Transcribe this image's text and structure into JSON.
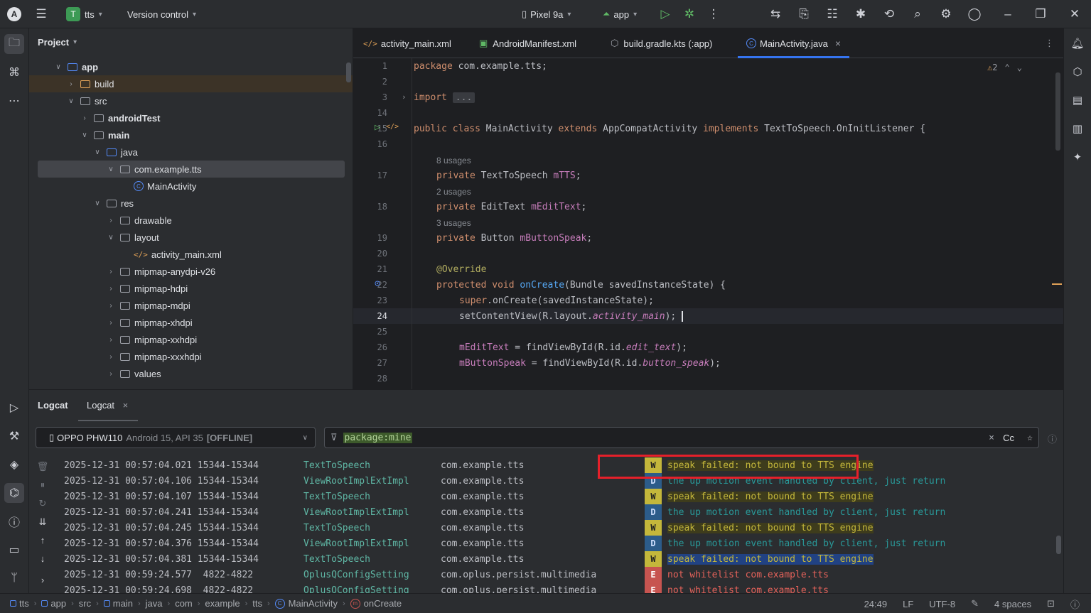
{
  "titlebar": {
    "project_badge": "T",
    "project_name": "tts",
    "vcs": "Version control",
    "device": "Pixel 9a",
    "run_config": "app"
  },
  "project_panel": {
    "title": "Project",
    "tree": [
      {
        "label": "app",
        "bold": true
      },
      {
        "label": "build"
      },
      {
        "label": "src"
      },
      {
        "label": "androidTest",
        "bold": true
      },
      {
        "label": "main",
        "bold": true
      },
      {
        "label": "java"
      },
      {
        "label": "com.example.tts"
      },
      {
        "label": "MainActivity"
      },
      {
        "label": "res"
      },
      {
        "label": "drawable"
      },
      {
        "label": "layout"
      },
      {
        "label": "activity_main.xml"
      },
      {
        "label": "mipmap-anydpi-v26"
      },
      {
        "label": "mipmap-hdpi"
      },
      {
        "label": "mipmap-mdpi"
      },
      {
        "label": "mipmap-xhdpi"
      },
      {
        "label": "mipmap-xxhdpi"
      },
      {
        "label": "mipmap-xxxhdpi"
      },
      {
        "label": "values"
      }
    ]
  },
  "tabs": [
    {
      "label": "activity_main.xml"
    },
    {
      "label": "AndroidManifest.xml"
    },
    {
      "label": "build.gradle.kts (:app)"
    },
    {
      "label": "MainActivity.java",
      "active": true
    }
  ],
  "editor": {
    "warnings": "2",
    "line_numbers": [
      "1",
      "2",
      "3",
      "14",
      "15",
      "16",
      "17",
      "18",
      "19",
      "20",
      "21",
      "22",
      "23",
      "24",
      "25",
      "26",
      "27",
      "28"
    ],
    "usages": [
      "8 usages",
      "2 usages",
      "3 usages"
    ],
    "code": {
      "l1_kw": "package",
      "l1_rest": " com.example.tts;",
      "l3_kw": "import",
      "l3_fold": "...",
      "l15_a": "public class",
      "l15_b": " MainActivity ",
      "l15_c": "extends",
      "l15_d": " AppCompatActivity ",
      "l15_e": "implements",
      "l15_f": " TextToSpeech.OnInitListener {",
      "l17_kw": "private",
      "l17_type": " TextToSpeech ",
      "l17_fld": "mTTS",
      "l17_end": ";",
      "l18_kw": "private",
      "l18_type": " EditText ",
      "l18_fld": "mEditText",
      "l18_end": ";",
      "l19_kw": "private",
      "l19_type": " Button ",
      "l19_fld": "mButtonSpeak",
      "l19_end": ";",
      "l21_anno": "@Override",
      "l22_kw": "protected void",
      "l22_fn": " onCreate",
      "l22_rest": "(Bundle savedInstanceState) {",
      "l23_kw": "super",
      "l23_rest": ".onCreate(savedInstanceState);",
      "l24_a": "setContentView(R.layout.",
      "l24_it": "activity_main",
      "l24_b": ");",
      "l26_fld": "mEditText",
      "l26_a": " = findViewById(R.id.",
      "l26_it": "edit_text",
      "l26_b": ");",
      "l27_fld": "mButtonSpeak",
      "l27_a": " = findViewById(R.id.",
      "l27_it": "button_speak",
      "l27_b": ");"
    }
  },
  "logcat": {
    "tabs": [
      "Logcat",
      "Logcat"
    ],
    "device": "OPPO PHW110",
    "device_detail": "Android 15, API 35",
    "device_status": "[OFFLINE]",
    "filter": "package:mine",
    "case_label": "Cc",
    "rows": [
      {
        "time": "2025-12-31 00:57:04.021 15344-15344",
        "tag": "TextToSpeech",
        "pkg": "com.example.tts",
        "level": "W",
        "msg": "speak failed: not bound to TTS engine"
      },
      {
        "time": "2025-12-31 00:57:04.106 15344-15344",
        "tag": "ViewRootImplExtImpl",
        "pkg": "com.example.tts",
        "level": "D",
        "msg": "the up motion event handled by client, just return"
      },
      {
        "time": "2025-12-31 00:57:04.107 15344-15344",
        "tag": "TextToSpeech",
        "pkg": "com.example.tts",
        "level": "W",
        "msg": "speak failed: not bound to TTS engine"
      },
      {
        "time": "2025-12-31 00:57:04.241 15344-15344",
        "tag": "ViewRootImplExtImpl",
        "pkg": "com.example.tts",
        "level": "D",
        "msg": "the up motion event handled by client, just return"
      },
      {
        "time": "2025-12-31 00:57:04.245 15344-15344",
        "tag": "TextToSpeech",
        "pkg": "com.example.tts",
        "level": "W",
        "msg": "speak failed: not bound to TTS engine"
      },
      {
        "time": "2025-12-31 00:57:04.376 15344-15344",
        "tag": "ViewRootImplExtImpl",
        "pkg": "com.example.tts",
        "level": "D",
        "msg": "the up motion event handled by client, just return"
      },
      {
        "time": "2025-12-31 00:57:04.381 15344-15344",
        "tag": "TextToSpeech",
        "pkg": "com.example.tts",
        "level": "W",
        "msg": "speak failed: not bound to TTS engine",
        "selected": true
      },
      {
        "time": "2025-12-31 00:59:24.577  4822-4822 ",
        "tag": "OplusQConfigSetting",
        "pkg": "com.oplus.persist.multimedia",
        "level": "E",
        "msg": "not whitelist com.example.tts"
      },
      {
        "time": "2025-12-31 00:59:24.698  4822-4822 ",
        "tag": "OplusQConfigSetting",
        "pkg": "com.oplus.persist.multimedia",
        "level": "E",
        "msg": "not whitelist com.example.tts"
      }
    ]
  },
  "statusbar": {
    "breadcrumb": [
      "tts",
      "app",
      "src",
      "main",
      "java",
      "com",
      "example",
      "tts",
      "MainActivity",
      "onCreate"
    ],
    "position": "24:49",
    "line_sep": "LF",
    "encoding": "UTF-8",
    "indent": "4 spaces"
  }
}
